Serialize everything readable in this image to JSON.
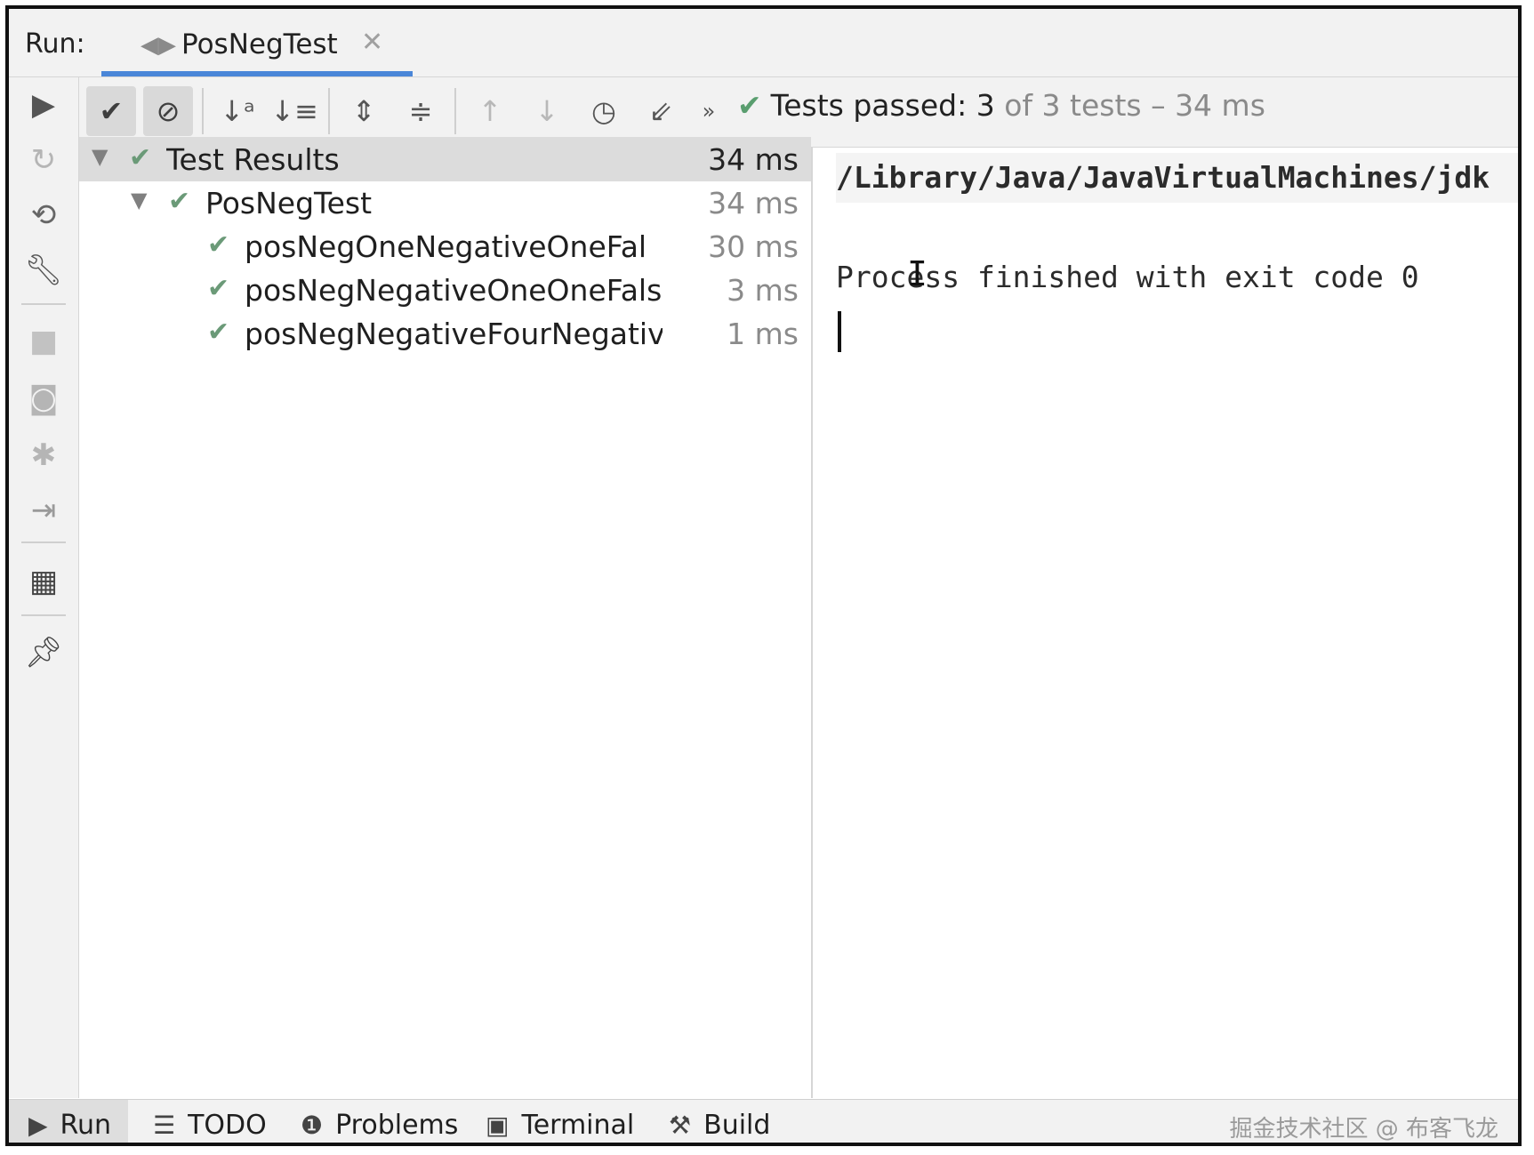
{
  "run_bar": {
    "label": "Run:",
    "tab": {
      "title": "PosNegTest",
      "icon": "run-config-icon",
      "close_icon": "close-icon"
    }
  },
  "left_toolbar": {
    "icons": [
      "rerun-icon",
      "rerun-failed-icon",
      "toggle-auto-test-icon",
      "settings-wrench-icon",
      "stop-icon",
      "snapshot-camera-icon",
      "debug-bug-icon",
      "import-icon",
      "layout-icon",
      "pin-icon"
    ]
  },
  "toolbar": {
    "icons": [
      "show-passed-icon",
      "show-ignored-icon",
      "sort-alpha-icon",
      "sort-duration-icon",
      "expand-all-icon",
      "collapse-all-icon",
      "prev-failed-icon",
      "next-failed-icon",
      "history-icon",
      "export-icon",
      "more-icon"
    ],
    "status": {
      "passed_text": "Tests passed: 3",
      "total_text": "of 3 tests – 34 ms"
    }
  },
  "tree": {
    "root": {
      "label": "Test Results",
      "duration": "34 ms"
    },
    "suite": {
      "label": "PosNegTest",
      "duration": "34 ms"
    },
    "tests": [
      {
        "label": "posNegOneNegativeOneFalse",
        "duration": "30 ms"
      },
      {
        "label": "posNegNegativeOneOneFalse()",
        "duration": "3 ms"
      },
      {
        "label": "posNegNegativeFourNegativeF",
        "duration": "1 ms"
      }
    ]
  },
  "console": {
    "command_line": "/Library/Java/JavaVirtualMachines/jdk",
    "message": "Process finished with exit code 0"
  },
  "bottom_bar": {
    "tabs": [
      {
        "label": "Run",
        "icon": "play-icon"
      },
      {
        "label": "TODO",
        "icon": "list-icon"
      },
      {
        "label": "Problems",
        "icon": "problems-icon"
      },
      {
        "label": "Terminal",
        "icon": "terminal-icon"
      },
      {
        "label": "Build",
        "icon": "hammer-icon"
      }
    ],
    "watermark": "掘金技术社区 @ 布客飞龙"
  }
}
